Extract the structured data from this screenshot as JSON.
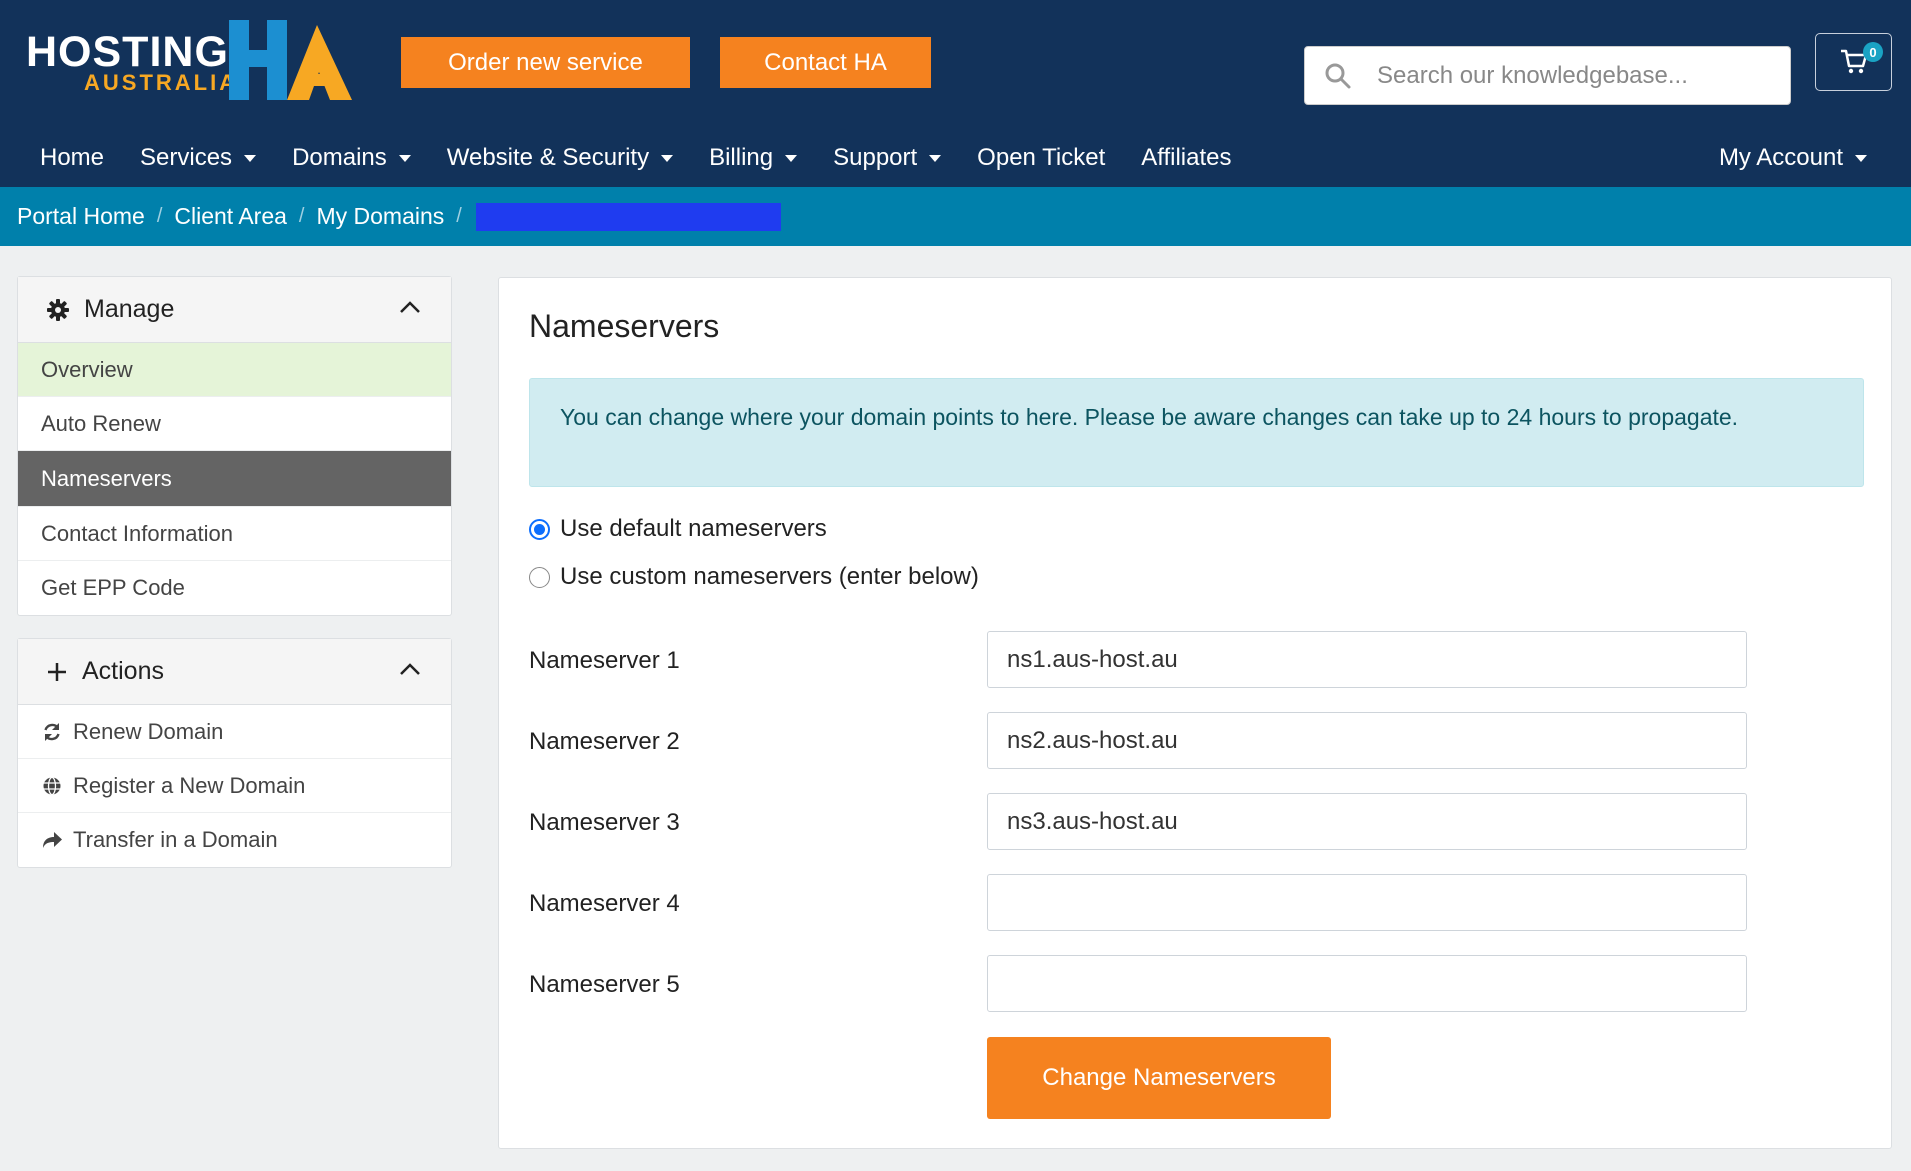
{
  "header": {
    "logo_text": "HOSTING",
    "logo_subtext": "AUSTRALIA",
    "order_button": "Order new service",
    "contact_button": "Contact HA",
    "search_placeholder": "Search our knowledgebase...",
    "cart_count": "0"
  },
  "nav": {
    "items": [
      {
        "label": "Home",
        "dropdown": false
      },
      {
        "label": "Services",
        "dropdown": true
      },
      {
        "label": "Domains",
        "dropdown": true
      },
      {
        "label": "Website & Security",
        "dropdown": true
      },
      {
        "label": "Billing",
        "dropdown": true
      },
      {
        "label": "Support",
        "dropdown": true
      },
      {
        "label": "Open Ticket",
        "dropdown": false
      },
      {
        "label": "Affiliates",
        "dropdown": false
      }
    ],
    "account": "My Account"
  },
  "breadcrumb": [
    "Portal Home",
    "Client Area",
    "My Domains"
  ],
  "sidebar": {
    "manage": {
      "title": "Manage",
      "items": [
        "Overview",
        "Auto Renew",
        "Nameservers",
        "Contact Information",
        "Get EPP Code"
      ]
    },
    "actions": {
      "title": "Actions",
      "items": [
        "Renew Domain",
        "Register a New Domain",
        "Transfer in a Domain"
      ]
    }
  },
  "main": {
    "title": "Nameservers",
    "alert": "You can change where your domain points to here. Please be aware changes can take up to 24 hours to propagate.",
    "radio_default": "Use default nameservers",
    "radio_custom": "Use custom nameservers (enter below)",
    "selected_option": "default",
    "nameservers": [
      {
        "label": "Nameserver 1",
        "value": "ns1.aus-host.au"
      },
      {
        "label": "Nameserver 2",
        "value": "ns2.aus-host.au"
      },
      {
        "label": "Nameserver 3",
        "value": "ns3.aus-host.au"
      },
      {
        "label": "Nameserver 4",
        "value": ""
      },
      {
        "label": "Nameserver 5",
        "value": ""
      }
    ],
    "submit": "Change Nameservers"
  },
  "colors": {
    "header_bg": "#12325a",
    "accent_orange": "#f5821f",
    "breadcrumb_bg": "#0080ab",
    "logo_blue": "#1c8fd1",
    "logo_yellow": "#f7a823"
  }
}
